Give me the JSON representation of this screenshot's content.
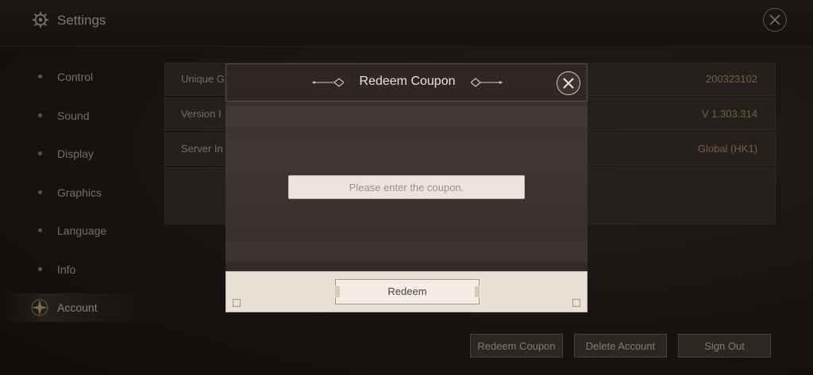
{
  "header": {
    "title": "Settings",
    "icons": {
      "settings": "gear-icon",
      "close": "close-icon"
    }
  },
  "sidebar": {
    "items": [
      {
        "label": "Control"
      },
      {
        "label": "Sound"
      },
      {
        "label": "Display"
      },
      {
        "label": "Graphics"
      },
      {
        "label": "Language"
      },
      {
        "label": "Info"
      },
      {
        "label": "Account",
        "active": true
      }
    ]
  },
  "account_info": {
    "rows": [
      {
        "key": "Unique G",
        "value": "200323102"
      },
      {
        "key": "Version I",
        "value": "V 1.303.314"
      },
      {
        "key": "Server In",
        "value": "Global (HK1)"
      }
    ]
  },
  "actions": {
    "redeem_coupon": "Redeem Coupon",
    "delete_account": "Delete Account",
    "sign_out": "Sign Out"
  },
  "modal": {
    "title": "Redeem Coupon",
    "input_placeholder": "Please enter the coupon.",
    "redeem_button": "Redeem"
  },
  "colors": {
    "accent_gold": "#c8a86a",
    "panel": "#3b332e",
    "modal_footer": "#e8e0d4"
  }
}
